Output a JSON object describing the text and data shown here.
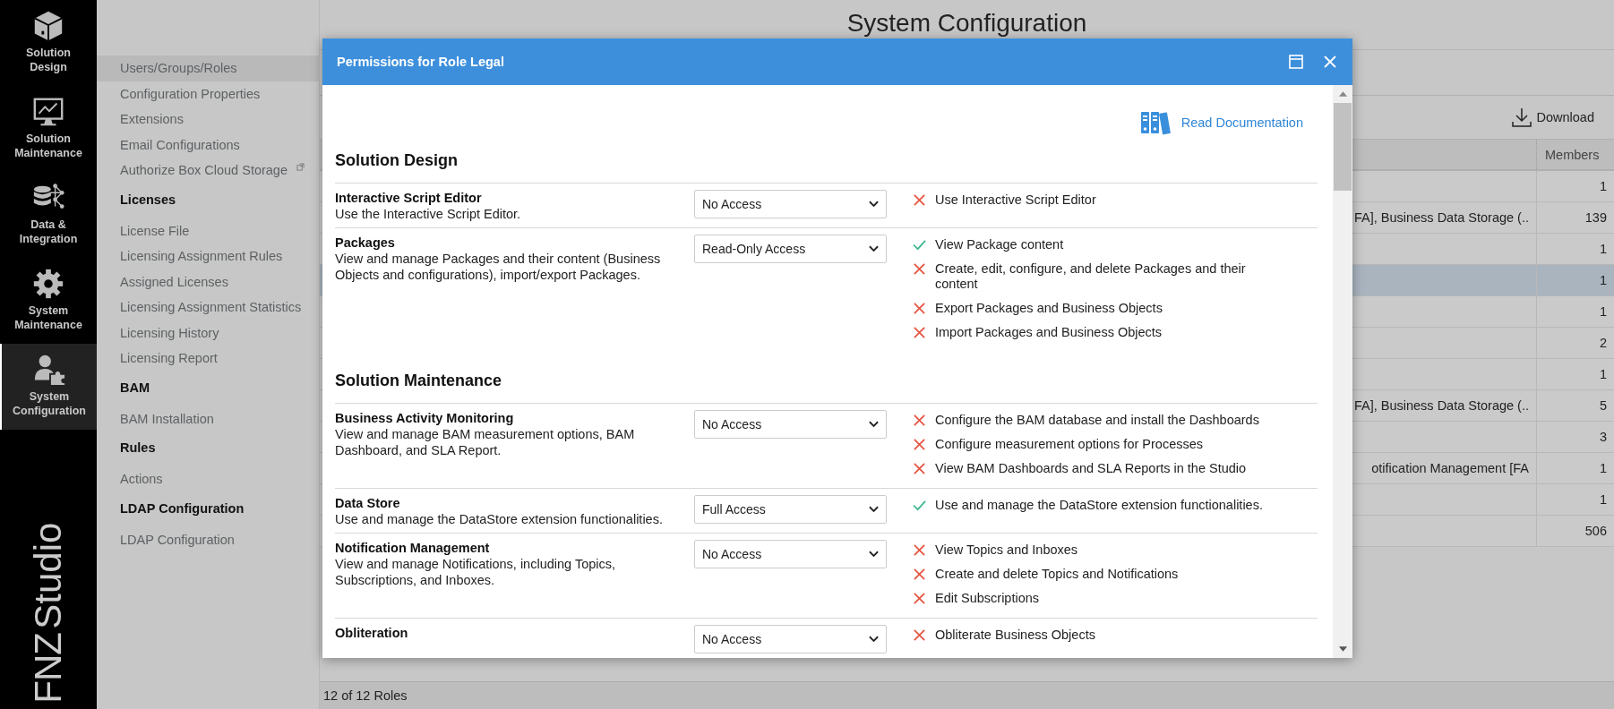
{
  "sidebar": {
    "items": [
      {
        "label": "Solution Design",
        "selected": false
      },
      {
        "label": "Solution Maintenance",
        "selected": false
      },
      {
        "label": "Data & Integration",
        "selected": false
      },
      {
        "label": "System Maintenance",
        "selected": false
      },
      {
        "label": "System Configuration",
        "selected": true
      }
    ],
    "brand": {
      "part_1": "FNZ",
      "part_2": "Studio"
    }
  },
  "page_title": "System Configuration",
  "nav": {
    "items": [
      {
        "kind": "link",
        "label": "Users/Groups/Roles",
        "selected": true,
        "external": false
      },
      {
        "kind": "link",
        "label": "Configuration Properties",
        "selected": false,
        "external": false
      },
      {
        "kind": "link",
        "label": "Extensions",
        "selected": false,
        "external": false
      },
      {
        "kind": "link",
        "label": "Email Configurations",
        "selected": false,
        "external": false
      },
      {
        "kind": "link",
        "label": "Authorize Box Cloud Storage",
        "selected": false,
        "external": true
      },
      {
        "kind": "heading",
        "label": "Licenses"
      },
      {
        "kind": "link",
        "label": "License File",
        "selected": false,
        "external": false
      },
      {
        "kind": "link",
        "label": "Licensing Assignment Rules",
        "selected": false,
        "external": false
      },
      {
        "kind": "link",
        "label": "Assigned Licenses",
        "selected": false,
        "external": false
      },
      {
        "kind": "link",
        "label": "Licensing Assignment Statistics",
        "selected": false,
        "external": false
      },
      {
        "kind": "link",
        "label": "Licensing History",
        "selected": false,
        "external": false
      },
      {
        "kind": "link",
        "label": "Licensing Report",
        "selected": false,
        "external": false
      },
      {
        "kind": "heading",
        "label": "BAM"
      },
      {
        "kind": "link",
        "label": "BAM Installation",
        "selected": false,
        "external": false
      },
      {
        "kind": "heading",
        "label": "Rules"
      },
      {
        "kind": "link",
        "label": "Actions",
        "selected": false,
        "external": false
      },
      {
        "kind": "heading",
        "label": "LDAP Configuration"
      },
      {
        "kind": "link",
        "label": "LDAP Configuration",
        "selected": false,
        "external": false
      }
    ]
  },
  "table": {
    "download_button": "Download",
    "columns": [
      "",
      "Members"
    ],
    "rows": [
      {
        "column_1": "",
        "members": "1",
        "selected": false
      },
      {
        "column_1": "FA], Business Data Storage (..",
        "members": "139",
        "selected": false
      },
      {
        "column_1": "",
        "members": "1",
        "selected": false
      },
      {
        "column_1": "",
        "members": "1",
        "selected": true
      },
      {
        "column_1": "",
        "members": "1",
        "selected": false
      },
      {
        "column_1": "",
        "members": "2",
        "selected": false
      },
      {
        "column_1": "",
        "members": "1",
        "selected": false
      },
      {
        "column_1": "FA], Business Data Storage (..",
        "members": "5",
        "selected": false
      },
      {
        "column_1": "",
        "members": "3",
        "selected": false
      },
      {
        "column_1": "otification Management [FA",
        "members": "1",
        "selected": false
      },
      {
        "column_1": "",
        "members": "1",
        "selected": false
      },
      {
        "column_1": "",
        "members": "506",
        "selected": false
      }
    ]
  },
  "status_bar": "12 of 12 Roles",
  "modal": {
    "title": "Permissions for Role Legal",
    "doc_link": "Read Documentation",
    "sections": [
      {
        "title": "Solution Design",
        "permissions": [
          {
            "name": "Interactive Script Editor",
            "description": "Use the Interactive Script Editor.",
            "access": "No Access",
            "rights": [
              {
                "label": "Use Interactive Script Editor",
                "granted": false
              }
            ]
          },
          {
            "name": "Packages",
            "description": "View and manage Packages and their content (Business Objects and configurations), import/export Packages.",
            "access": "Read-Only Access",
            "rights": [
              {
                "label": "View Package content",
                "granted": true
              },
              {
                "label": "Create, edit, configure, and delete Packages and their content",
                "granted": false
              },
              {
                "label": "Export Packages and Business Objects",
                "granted": false
              },
              {
                "label": "Import Packages and Business Objects",
                "granted": false
              }
            ]
          }
        ]
      },
      {
        "title": "Solution Maintenance",
        "permissions": [
          {
            "name": "Business Activity Monitoring",
            "description": "View and manage BAM measurement options, BAM Dashboard, and SLA Report.",
            "access": "No Access",
            "rights": [
              {
                "label": "Configure the BAM database and install the Dashboards",
                "granted": false
              },
              {
                "label": "Configure measurement options for Processes",
                "granted": false
              },
              {
                "label": "View BAM Dashboards and SLA Reports in the Studio",
                "granted": false
              }
            ]
          },
          {
            "name": "Data Store",
            "description": "Use and manage the DataStore extension functionalities.",
            "access": "Full Access",
            "rights": [
              {
                "label": "Use and manage the DataStore extension functionalities.",
                "granted": true
              }
            ]
          },
          {
            "name": "Notification Management",
            "description": "View and manage Notifications, including Topics, Subscriptions, and Inboxes.",
            "access": "No Access",
            "rights": [
              {
                "label": "View Topics and Inboxes",
                "granted": false
              },
              {
                "label": "Create and delete Topics and Notifications",
                "granted": false
              },
              {
                "label": "Edit Subscriptions",
                "granted": false
              }
            ]
          },
          {
            "name": "Obliteration",
            "access": "No Access",
            "rights": [
              {
                "label": "Obliterate Business Objects",
                "granted": false
              }
            ]
          }
        ]
      }
    ]
  }
}
